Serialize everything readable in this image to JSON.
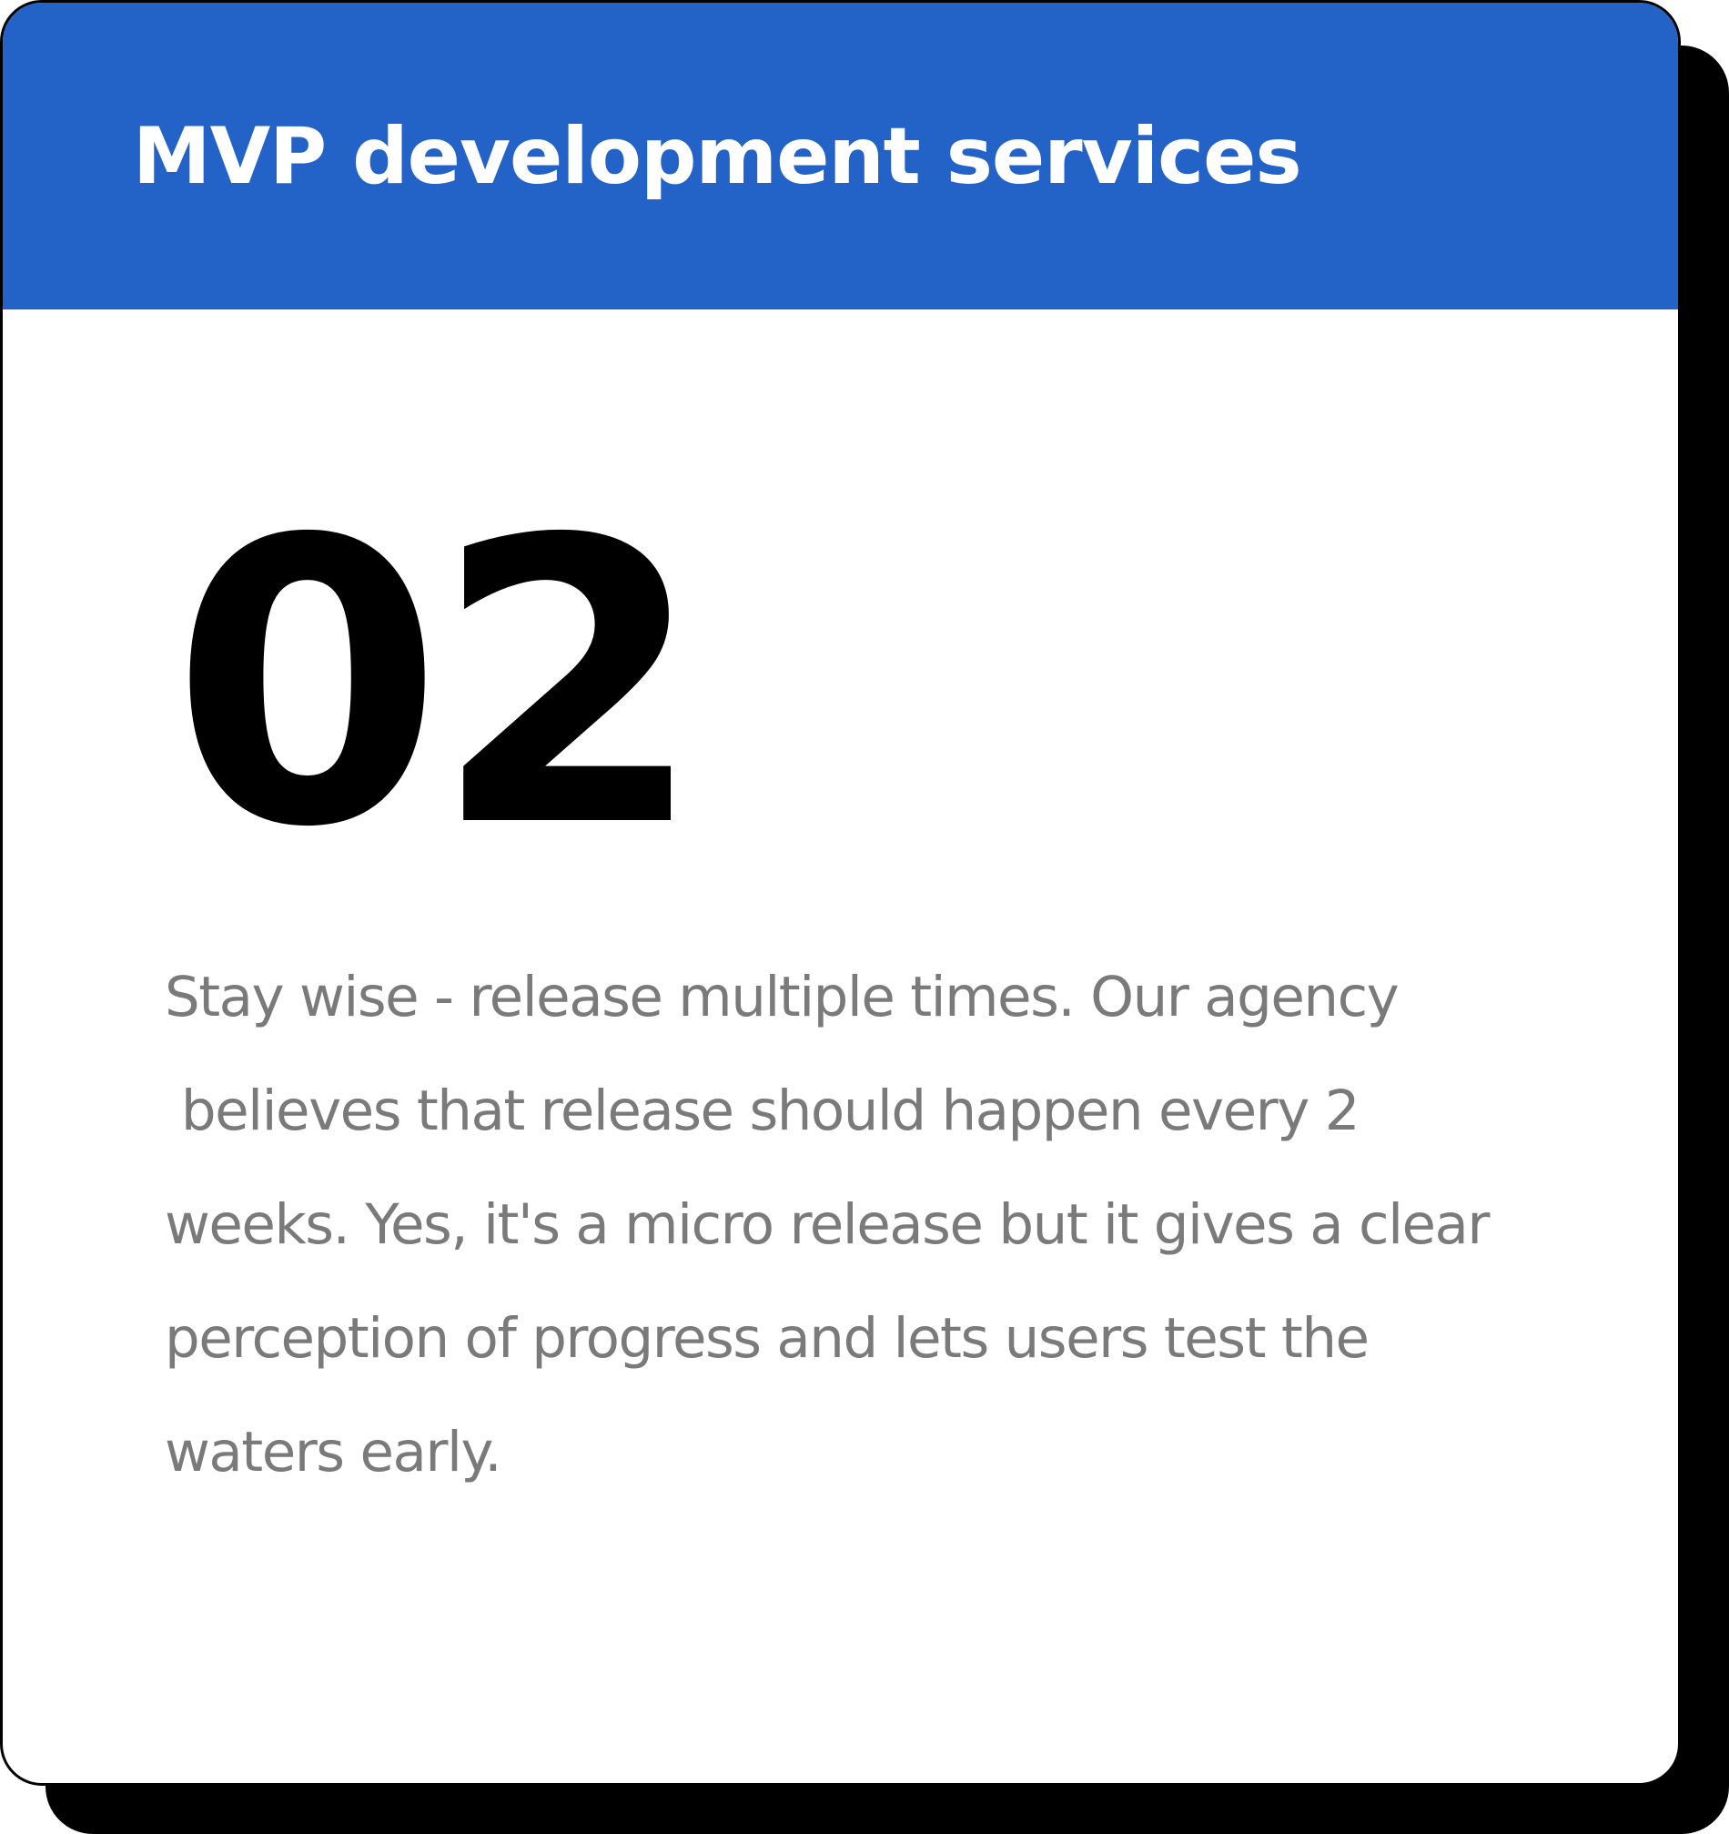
{
  "card": {
    "title": "MVP development services",
    "step_number": "02",
    "description_lines": [
      "Stay wise - release multiple times. Our agency",
      " believes that release should happen every 2",
      "weeks. Yes, it's a micro release but it gives a clear",
      "perception of progress and lets users test the",
      "waters early."
    ]
  },
  "colors": {
    "header_background": "#2363c7",
    "header_text": "#ffffff",
    "card_background": "#ffffff",
    "card_border": "#000000",
    "shadow": "#000000",
    "number_text": "#000000",
    "body_text": "#7a7a7a"
  }
}
